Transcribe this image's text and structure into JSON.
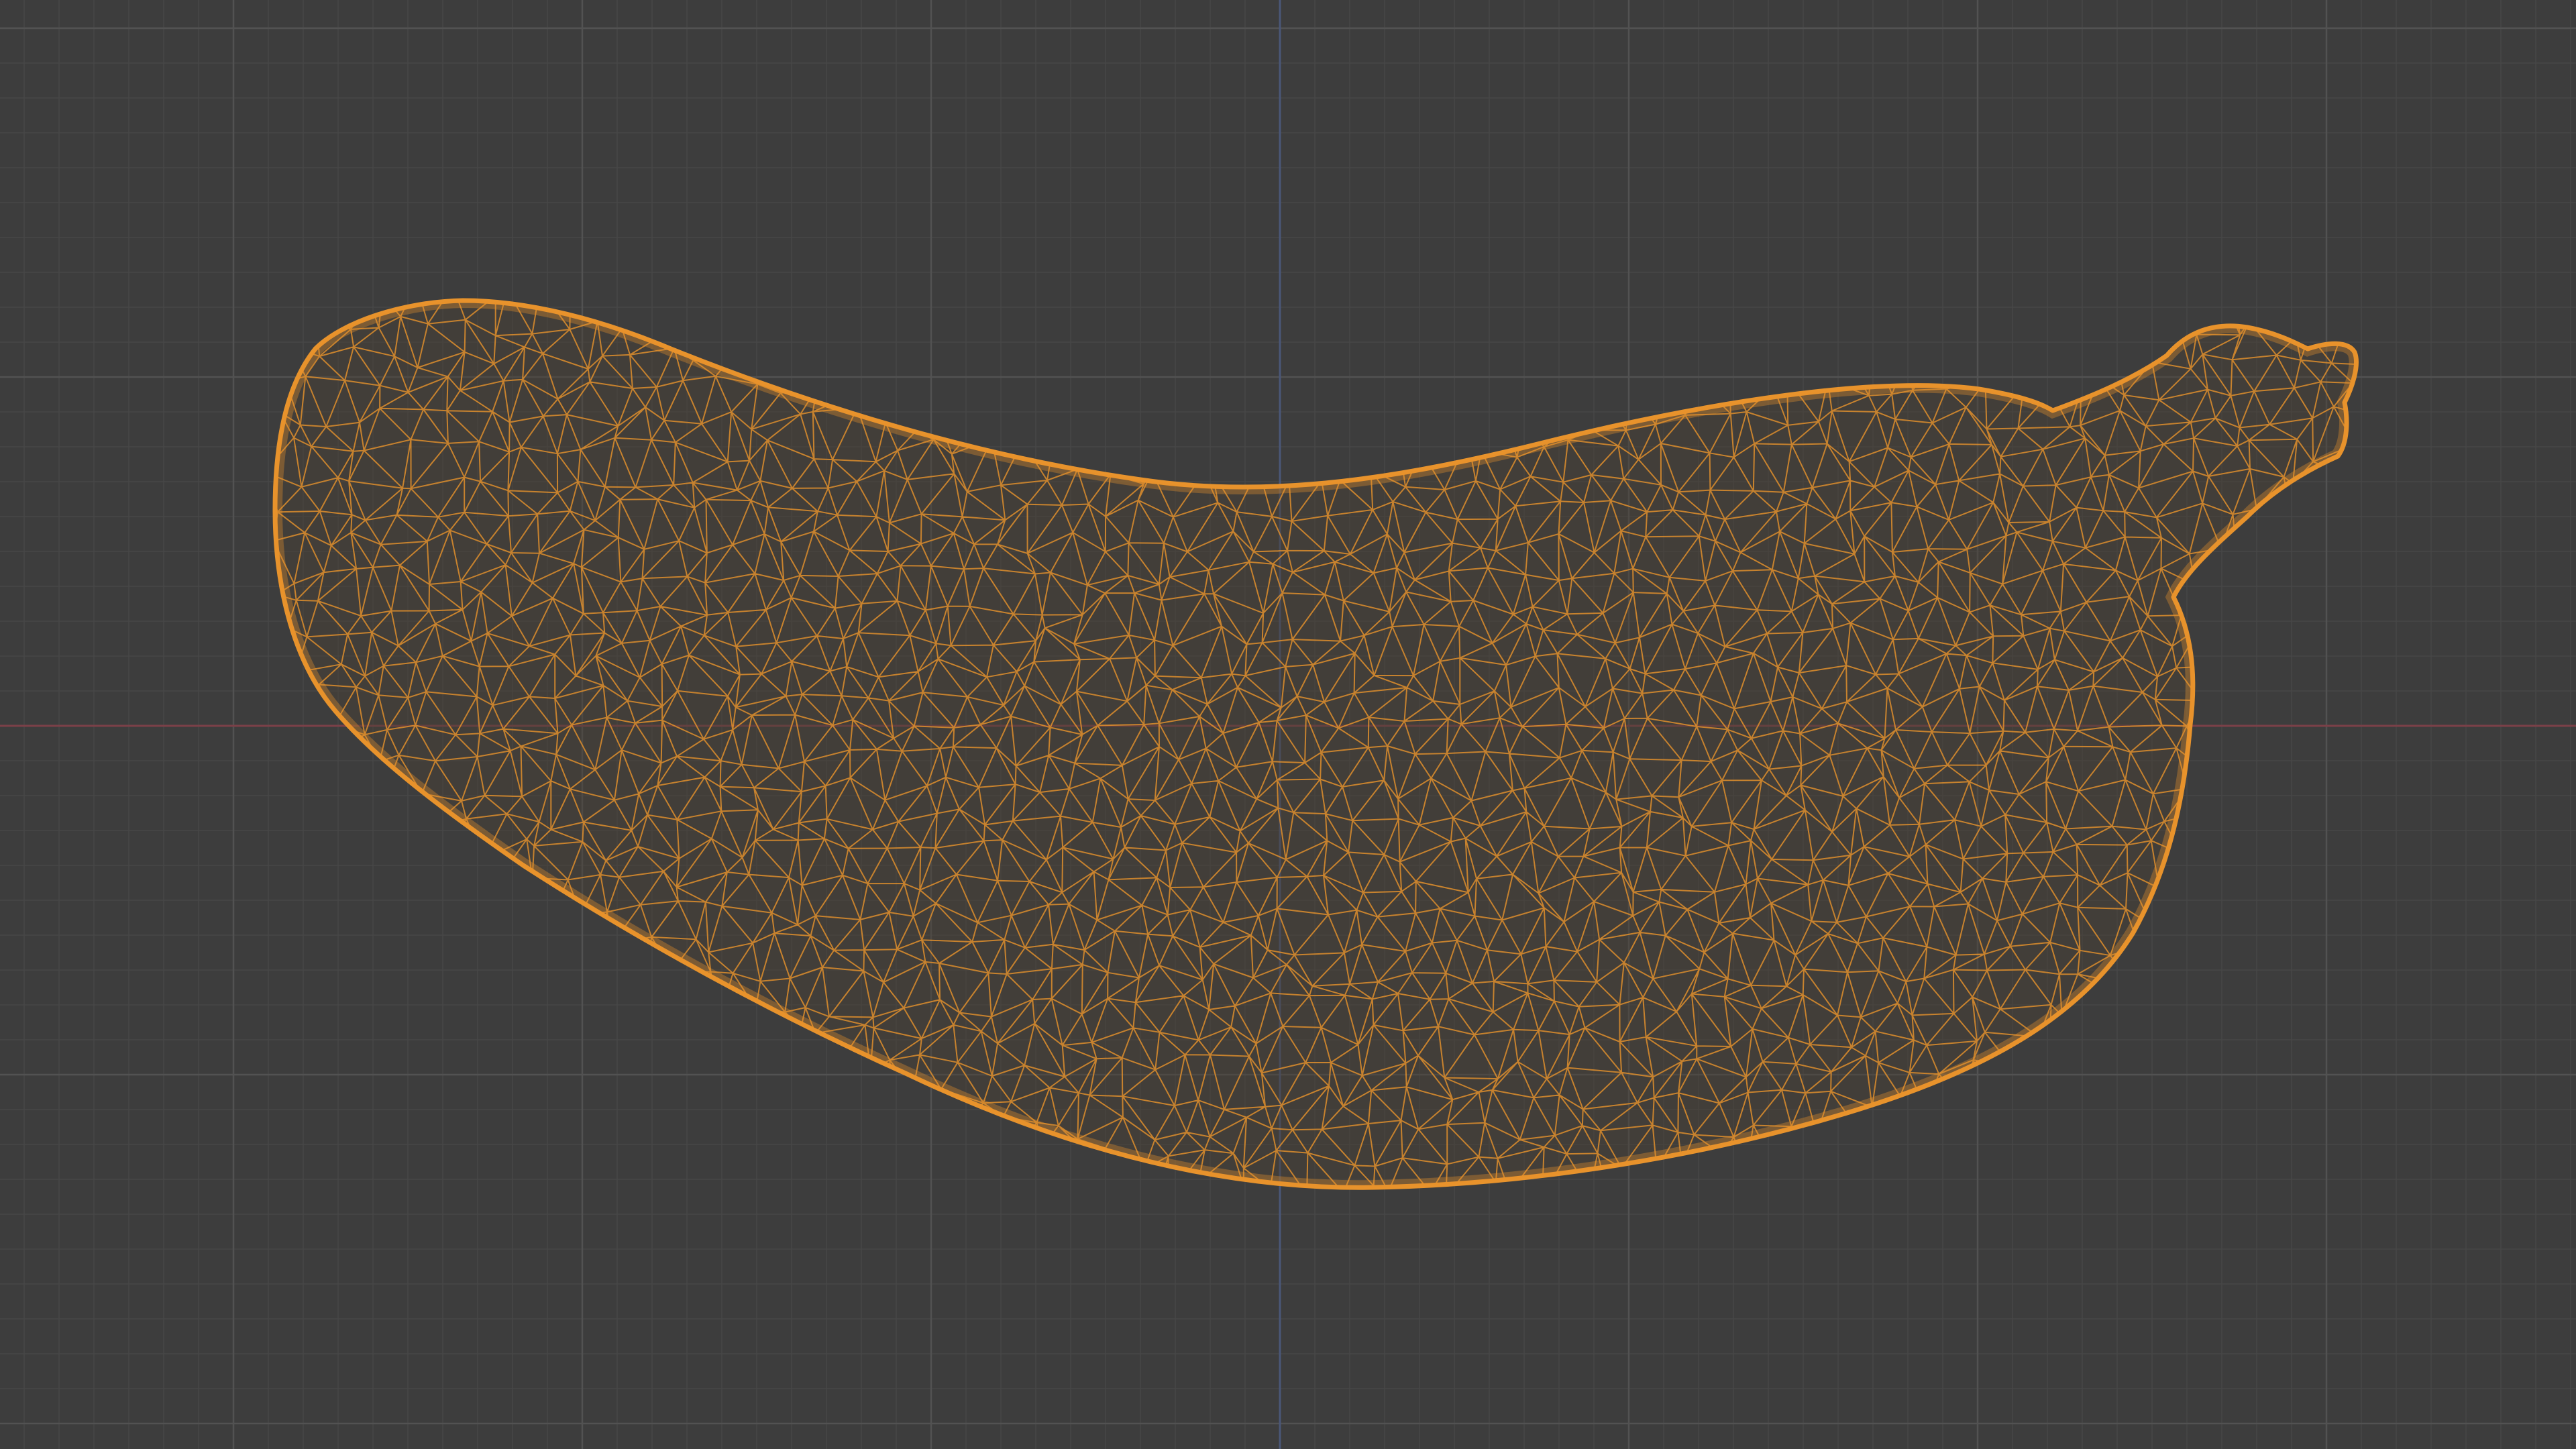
{
  "viewport": {
    "background_color": "#3d3d3d",
    "grid_minor_color": "#474747",
    "grid_major_color": "#525252",
    "x_axis_color": "#7a4048",
    "z_axis_color": "#4a5778"
  },
  "object": {
    "mode": "wireframe",
    "shape_icon": "banana-mesh",
    "wire_color": "#e8932c",
    "fill_color": "#4a4035",
    "selected": true
  }
}
